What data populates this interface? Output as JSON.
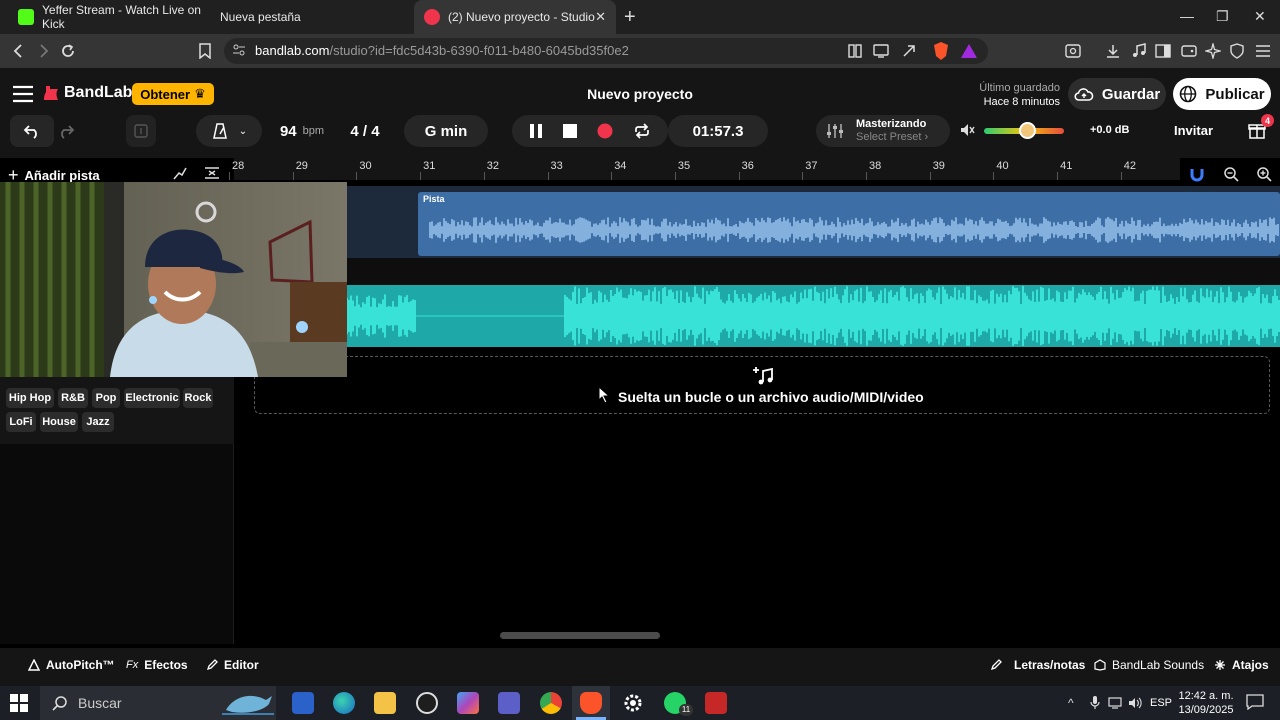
{
  "browser": {
    "tabs": [
      {
        "title": "Yeffer Stream - Watch Live on Kick",
        "favicon_color": "#53fc18"
      },
      {
        "title": "Nueva pestaña",
        "favicon_color": "#ffffff"
      },
      {
        "title": "(2) Nuevo proyecto - Studio",
        "favicon_color": "#f0344c",
        "active": true
      }
    ],
    "url_host": "bandlab.com",
    "url_path": "/studio?id=fdc5d43b-6390-f011-b480-6045bd35f0e2"
  },
  "app": {
    "brand": "BandLab",
    "get_button": "Obtener",
    "project_title": "Nuevo proyecto",
    "last_saved_label": "Último guardado",
    "last_saved_time": "Hace 8 minutos",
    "save_button": "Guardar",
    "publish_button": "Publicar",
    "invite_button": "Invitar",
    "gift_badge_count": "4",
    "accent_color": "#f0344c"
  },
  "toolbar": {
    "bpm_value": "94",
    "bpm_unit": "bpm",
    "time_signature": "4 / 4",
    "key": "G min",
    "time_display": "01:57.3",
    "mastering_label": "Masterizando",
    "mastering_preset": "Select Preset",
    "volume_db": "+0.0 dB",
    "volume_level": 0.55
  },
  "timeline": {
    "add_track": "Añadir pista",
    "bars": [
      "28",
      "29",
      "30",
      "31",
      "32",
      "33",
      "34",
      "35",
      "36",
      "37",
      "38",
      "39",
      "40",
      "41",
      "42"
    ],
    "clip1_label": "Pista",
    "drop_hint": "Suelta un bucle o un archivo audio/MIDI/video",
    "track_colors": {
      "track1": "#3d6ea6",
      "track2": "#1ea8a8"
    }
  },
  "genres": [
    "Hip Hop",
    "R&B",
    "Pop",
    "Electronic",
    "Rock",
    "LoFi",
    "House",
    "Jazz"
  ],
  "bottom": {
    "autopitch": "AutoPitch™",
    "effects": "Efectos",
    "editor": "Editor",
    "lyrics": "Letras/notas",
    "sounds": "BandLab Sounds",
    "shortcuts": "Atajos"
  },
  "taskbar": {
    "search_placeholder": "Buscar",
    "language": "ESP",
    "time": "12:42 a. m.",
    "date": "13/09/2025",
    "whatsapp_badge": "11"
  }
}
